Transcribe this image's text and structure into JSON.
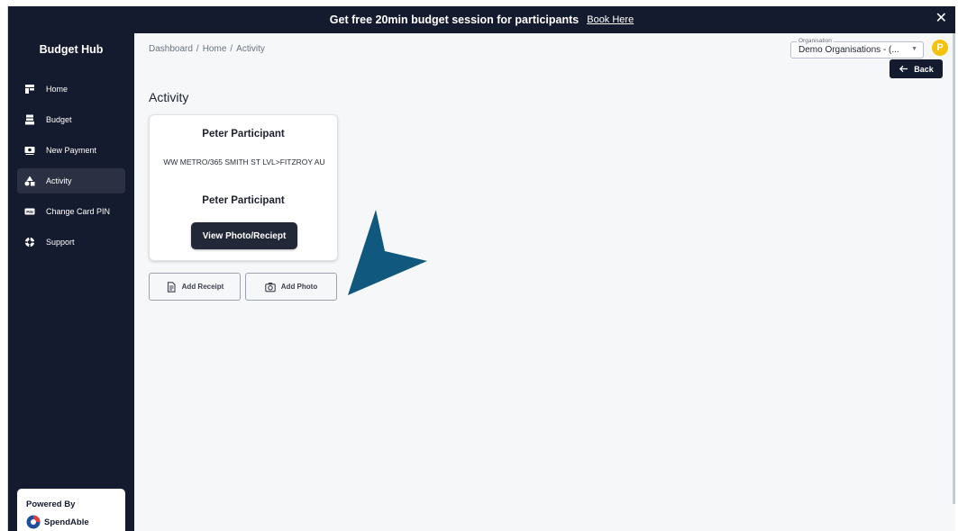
{
  "banner": {
    "message": "Get free 20min budget session for participants",
    "link_label": "Book Here",
    "close_label": "✕"
  },
  "sidebar": {
    "brand": "Budget Hub",
    "items": [
      {
        "label": "Home",
        "icon": "home-icon",
        "active": false
      },
      {
        "label": "Budget",
        "icon": "budget-icon",
        "active": false
      },
      {
        "label": "New Payment",
        "icon": "payment-icon",
        "active": false
      },
      {
        "label": "Activity",
        "icon": "activity-icon",
        "active": true
      },
      {
        "label": "Change Card PIN",
        "icon": "pin-icon",
        "active": false
      },
      {
        "label": "Support",
        "icon": "support-icon",
        "active": false
      }
    ],
    "powered_by": {
      "label": "Powered By",
      "logo_text": "SpendAble"
    }
  },
  "header": {
    "breadcrumb": [
      "Dashboard",
      "Home",
      "Activity"
    ],
    "organisation": {
      "label": "Organisation",
      "value": "Demo Organisations - (..."
    },
    "avatar_initial": "P",
    "back_label": "Back"
  },
  "main": {
    "title": "Activity",
    "card": {
      "name": "Peter Participant",
      "merchant": "WW METRO/365 SMITH ST LVL>FITZROY AU",
      "payee": "Peter Participant",
      "view_button": "View Photo/Reciept"
    },
    "actions": {
      "add_receipt": "Add Receipt",
      "add_photo": "Add Photo"
    }
  },
  "colors": {
    "sidebar_bg": "#151b2e",
    "accent_yellow": "#f4c20d",
    "pointer_blue": "#10587d"
  }
}
